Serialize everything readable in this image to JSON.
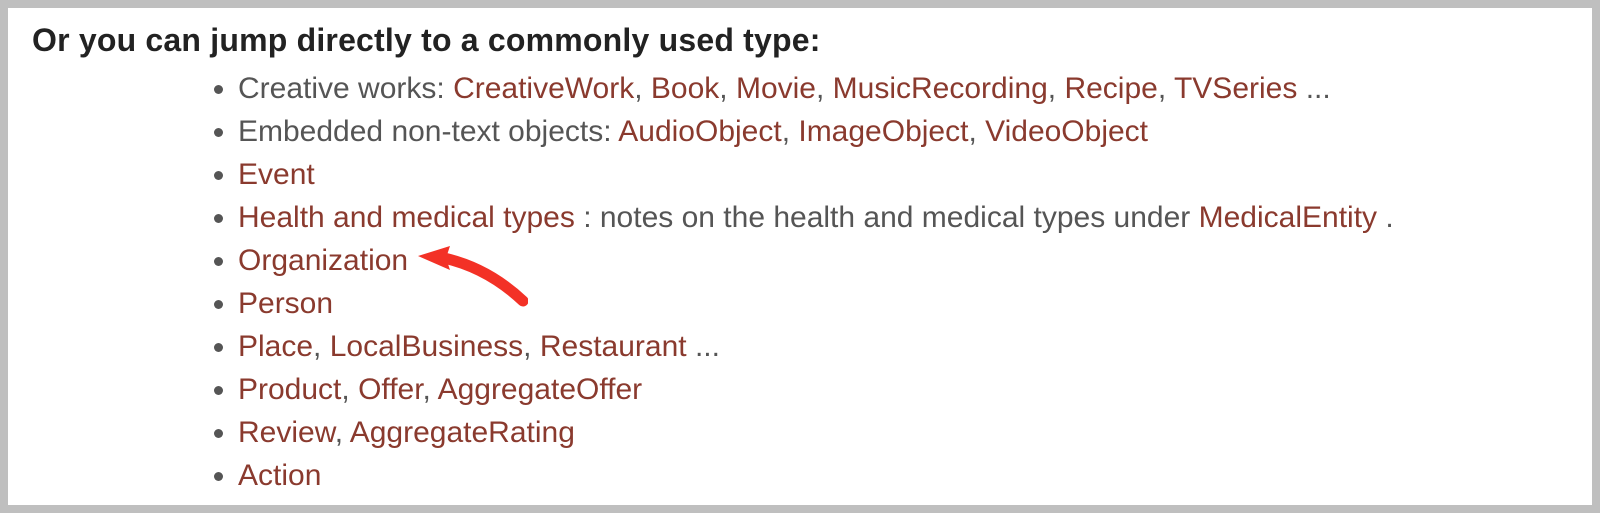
{
  "heading": "Or you can jump directly to a commonly used type:",
  "items": [
    {
      "prefix": "Creative works: ",
      "links": [
        "CreativeWork",
        "Book",
        "Movie",
        "MusicRecording",
        "Recipe",
        "TVSeries"
      ],
      "suffix": " ..."
    },
    {
      "prefix": "Embedded non-text objects: ",
      "links": [
        "AudioObject",
        "ImageObject",
        "VideoObject"
      ],
      "suffix": ""
    },
    {
      "prefix": "",
      "links": [
        "Event"
      ],
      "suffix": ""
    },
    {
      "prefix": "",
      "links_lead": "Health and medical types",
      "mid": ": notes on the health and medical types under ",
      "links_tail": "MedicalEntity",
      "suffix": "."
    },
    {
      "prefix": "",
      "links": [
        "Organization"
      ],
      "suffix": ""
    },
    {
      "prefix": "",
      "links": [
        "Person"
      ],
      "suffix": ""
    },
    {
      "prefix": "",
      "links": [
        "Place",
        "LocalBusiness",
        "Restaurant"
      ],
      "suffix": " ..."
    },
    {
      "prefix": "",
      "links": [
        "Product",
        "Offer",
        "AggregateOffer"
      ],
      "suffix": ""
    },
    {
      "prefix": "",
      "links": [
        "Review",
        "AggregateRating"
      ],
      "suffix": ""
    },
    {
      "prefix": "",
      "links": [
        "Action"
      ],
      "suffix": ""
    }
  ],
  "arrow_target_index": 4
}
